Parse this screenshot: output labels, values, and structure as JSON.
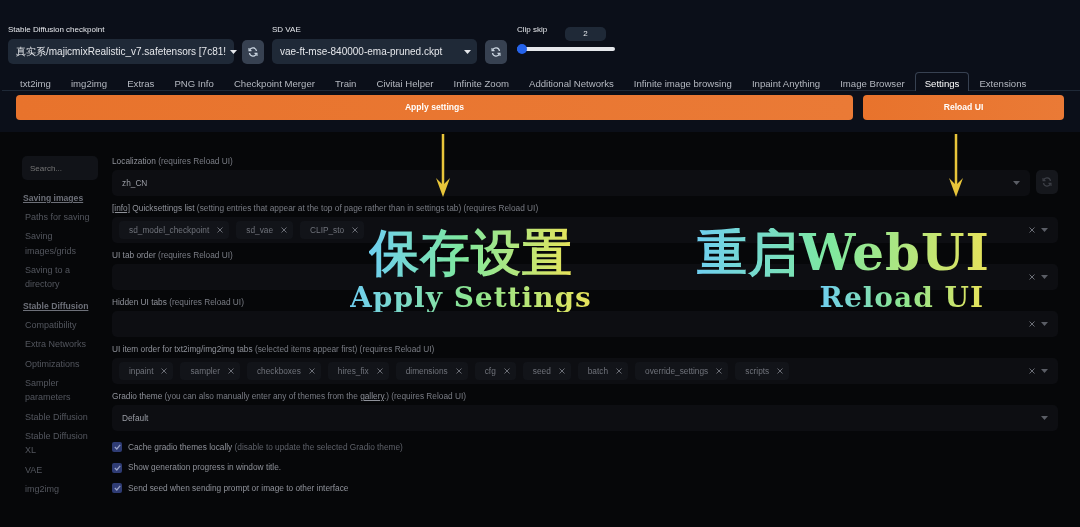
{
  "quicksettings": {
    "checkpoint": {
      "label": "Stable Diffusion checkpoint",
      "value": "真实系/majicmixRealistic_v7.safetensors [7c81!"
    },
    "vae": {
      "label": "SD VAE",
      "value": "vae-ft-mse-840000-ema-pruned.ckpt"
    },
    "clip_skip": {
      "label": "Clip skip",
      "value": "2",
      "level": 0.05
    }
  },
  "tabs": [
    {
      "label": "txt2img",
      "selected": false
    },
    {
      "label": "img2img",
      "selected": false
    },
    {
      "label": "Extras",
      "selected": false
    },
    {
      "label": "PNG Info",
      "selected": false
    },
    {
      "label": "Checkpoint Merger",
      "selected": false
    },
    {
      "label": "Train",
      "selected": false
    },
    {
      "label": "Civitai Helper",
      "selected": false
    },
    {
      "label": "Infinite Zoom",
      "selected": false
    },
    {
      "label": "Additional Networks",
      "selected": false
    },
    {
      "label": "Infinite image browsing",
      "selected": false
    },
    {
      "label": "Inpaint Anything",
      "selected": false
    },
    {
      "label": "Image Browser",
      "selected": false
    },
    {
      "label": "Settings",
      "selected": true
    },
    {
      "label": "Extensions",
      "selected": false
    }
  ],
  "buttons": [
    "Apply settings",
    "Reload UI"
  ],
  "sidebar": {
    "search_placeholder": "Search...",
    "sections": [
      {
        "title": "Saving images",
        "items": [
          "Paths for saving",
          "Saving images/grids",
          "Saving to a directory"
        ]
      },
      {
        "title": "Stable Diffusion",
        "items": [
          "Compatibility",
          "Extra Networks",
          "Optimizations",
          "Sampler parameters",
          "Stable Diffusion",
          "Stable Diffusion XL",
          "VAE",
          "img2img"
        ]
      }
    ]
  },
  "settings": [
    {
      "kind": "dropdown",
      "label": "Localization",
      "note": "(requires Reload UI)",
      "value": "zh_CN",
      "refresh": true
    },
    {
      "kind": "chips",
      "info": "[info]",
      "label": "Quicksettings list",
      "note": "(setting entries that appear at the top of page rather than in settings tab) (requires Reload UI)",
      "chips": [
        "sd_model_checkpoint",
        "sd_vae",
        "CLIP_sto"
      ]
    },
    {
      "kind": "chips",
      "label": "UI tab order",
      "note": "(requires Reload UI)"
    },
    {
      "kind": "chips",
      "label": "Hidden UI tabs",
      "note": "(requires Reload UI)"
    },
    {
      "kind": "chips",
      "label": "UI item order for txt2img/img2img tabs",
      "note": "(selected items appear first) (requires Reload UI)",
      "chips": [
        "inpaint",
        "sampler",
        "checkboxes",
        "hires_fix",
        "dimensions",
        "cfg",
        "seed",
        "batch",
        "override_settings",
        "scripts"
      ]
    },
    {
      "kind": "dropdown",
      "label": "Gradio theme",
      "note": "(you can also manually enter any of themes from the",
      "link": "gallery",
      "note_after": ".) (requires Reload UI)",
      "value": "Default"
    }
  ],
  "checkboxes": [
    {
      "label": "Cache gradio themes locally",
      "note": "(disable to update the selected Gradio theme)",
      "checked": true
    },
    {
      "label": "Show generation progress in window title.",
      "checked": true
    },
    {
      "label": "Send seed when sending prompt or image to other interface",
      "checked": true
    }
  ],
  "annotations": [
    {
      "title": "保存设置",
      "subtitle": "Apply Settings"
    },
    {
      "title": "重启WebUI",
      "subtitle": "Reload UI"
    }
  ]
}
